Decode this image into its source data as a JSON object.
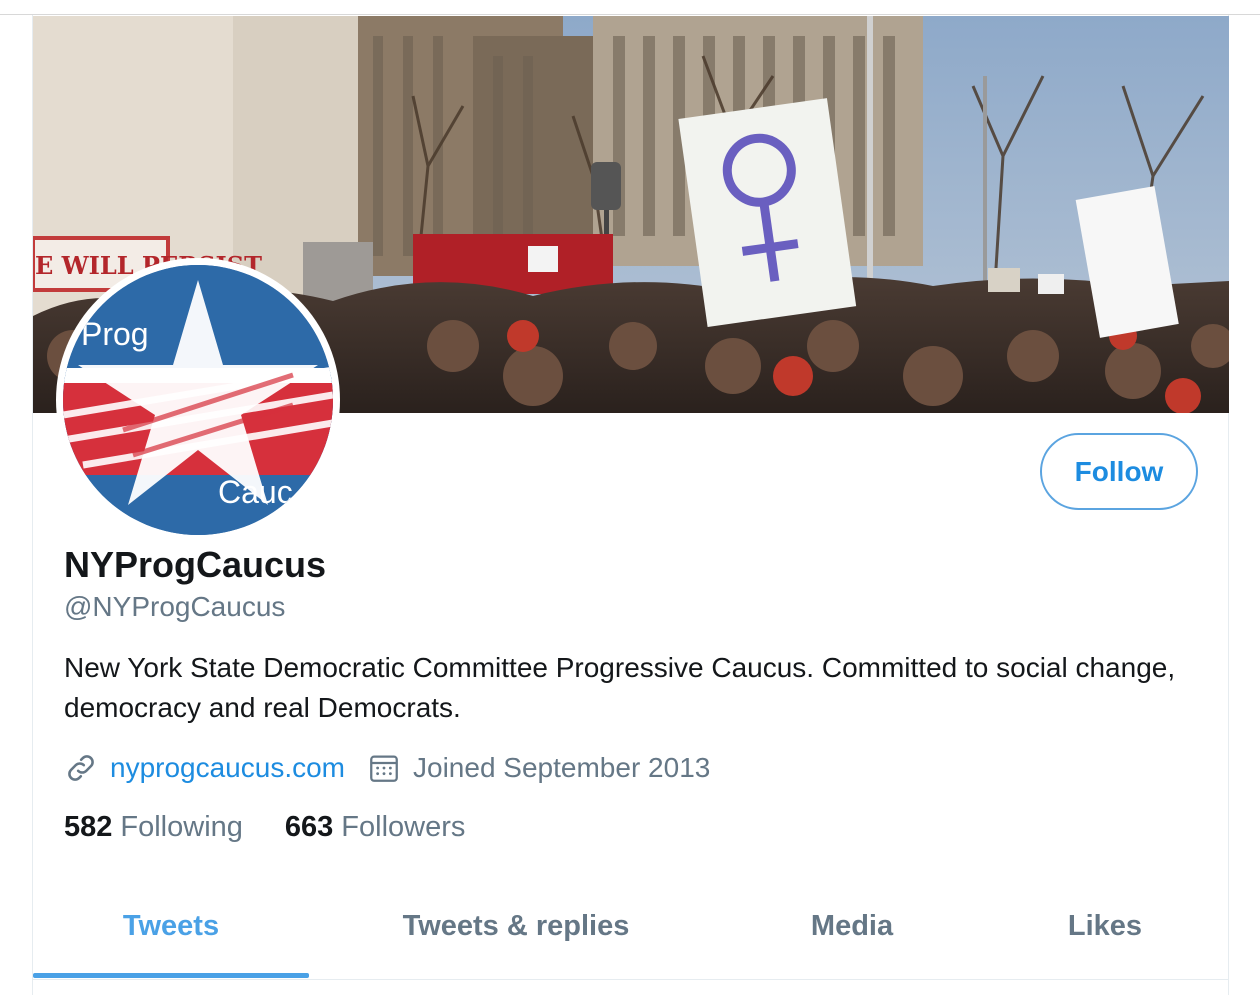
{
  "banner": {
    "sign_text": "E WILL PERSIST",
    "placard_symbol": "female-symbol"
  },
  "avatar": {
    "text_top": "Prog",
    "text_bottom": "Cauc",
    "colors": {
      "blue": "#2d6aa8",
      "red": "#d6303c",
      "white": "#ffffff"
    }
  },
  "profile": {
    "display_name": "NYProgCaucus",
    "handle": "@NYProgCaucus",
    "bio": "New York State Democratic Committee Progressive Caucus. Committed to social change, democracy and real Democrats.",
    "website": "nyprogcaucus.com",
    "joined": "Joined September 2013",
    "following_count": "582",
    "following_label": "Following",
    "followers_count": "663",
    "followers_label": "Followers"
  },
  "actions": {
    "follow_label": "Follow"
  },
  "tabs": [
    {
      "label": "Tweets",
      "active": true
    },
    {
      "label": "Tweets & replies",
      "active": false
    },
    {
      "label": "Media",
      "active": false
    },
    {
      "label": "Likes",
      "active": false
    }
  ],
  "colors": {
    "accent": "#1d8ce0",
    "tab_active": "#4aa1e6",
    "secondary_text": "#657786",
    "primary_text": "#14171a"
  },
  "icons": {
    "link": "link-icon",
    "calendar": "calendar-icon"
  }
}
